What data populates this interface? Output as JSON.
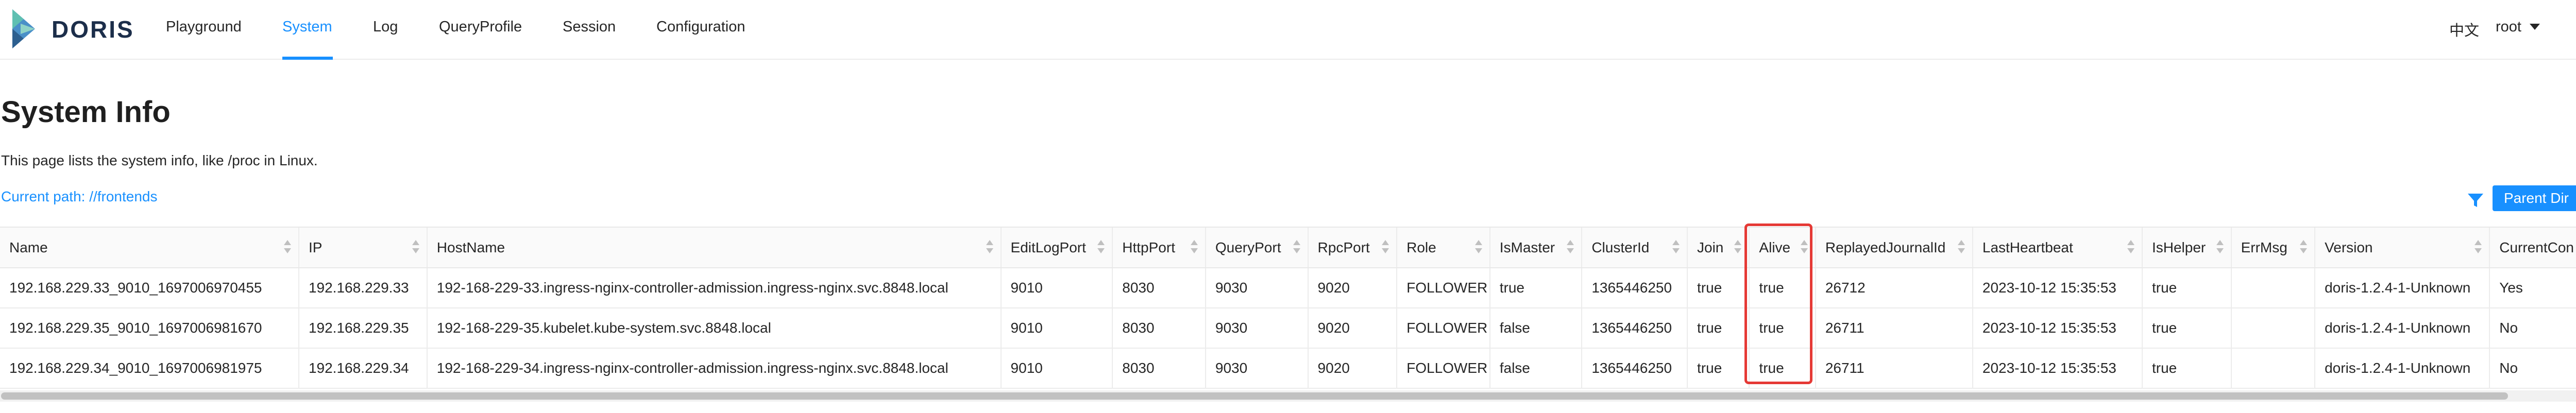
{
  "brand": {
    "name": "DORIS"
  },
  "nav": {
    "items": [
      {
        "label": "Playground",
        "active": false
      },
      {
        "label": "System",
        "active": true
      },
      {
        "label": "Log",
        "active": false
      },
      {
        "label": "QueryProfile",
        "active": false
      },
      {
        "label": "Session",
        "active": false
      },
      {
        "label": "Configuration",
        "active": false
      }
    ],
    "language": "中文",
    "user": "root"
  },
  "header": {
    "title": "System Info",
    "description": "This page lists the system info, like /proc in Linux.",
    "current_path": "Current path: //frontends",
    "parent_dir_label": "Parent Dir"
  },
  "table": {
    "columns": [
      "Name",
      "IP",
      "HostName",
      "EditLogPort",
      "HttpPort",
      "QueryPort",
      "RpcPort",
      "Role",
      "IsMaster",
      "ClusterId",
      "Join",
      "Alive",
      "ReplayedJournalId",
      "LastHeartbeat",
      "IsHelper",
      "ErrMsg",
      "Version",
      "CurrentCon"
    ],
    "rows": [
      [
        "192.168.229.33_9010_1697006970455",
        "192.168.229.33",
        "192-168-229-33.ingress-nginx-controller-admission.ingress-nginx.svc.8848.local",
        "9010",
        "8030",
        "9030",
        "9020",
        "FOLLOWER",
        "true",
        "1365446250",
        "true",
        "true",
        "26712",
        "2023-10-12 15:35:53",
        "true",
        "",
        "doris-1.2.4-1-Unknown",
        "Yes"
      ],
      [
        "192.168.229.35_9010_1697006981670",
        "192.168.229.35",
        "192-168-229-35.kubelet.kube-system.svc.8848.local",
        "9010",
        "8030",
        "9030",
        "9020",
        "FOLLOWER",
        "false",
        "1365446250",
        "true",
        "true",
        "26711",
        "2023-10-12 15:35:53",
        "true",
        "",
        "doris-1.2.4-1-Unknown",
        "No"
      ],
      [
        "192.168.229.34_9010_1697006981975",
        "192.168.229.34",
        "192-168-229-34.ingress-nginx-controller-admission.ingress-nginx.svc.8848.local",
        "9010",
        "8030",
        "9030",
        "9020",
        "FOLLOWER",
        "false",
        "1365446250",
        "true",
        "true",
        "26711",
        "2023-10-12 15:35:53",
        "true",
        "",
        "doris-1.2.4-1-Unknown",
        "No"
      ]
    ]
  },
  "colors": {
    "accent": "#1890ff",
    "highlight_border": "#e53935"
  }
}
